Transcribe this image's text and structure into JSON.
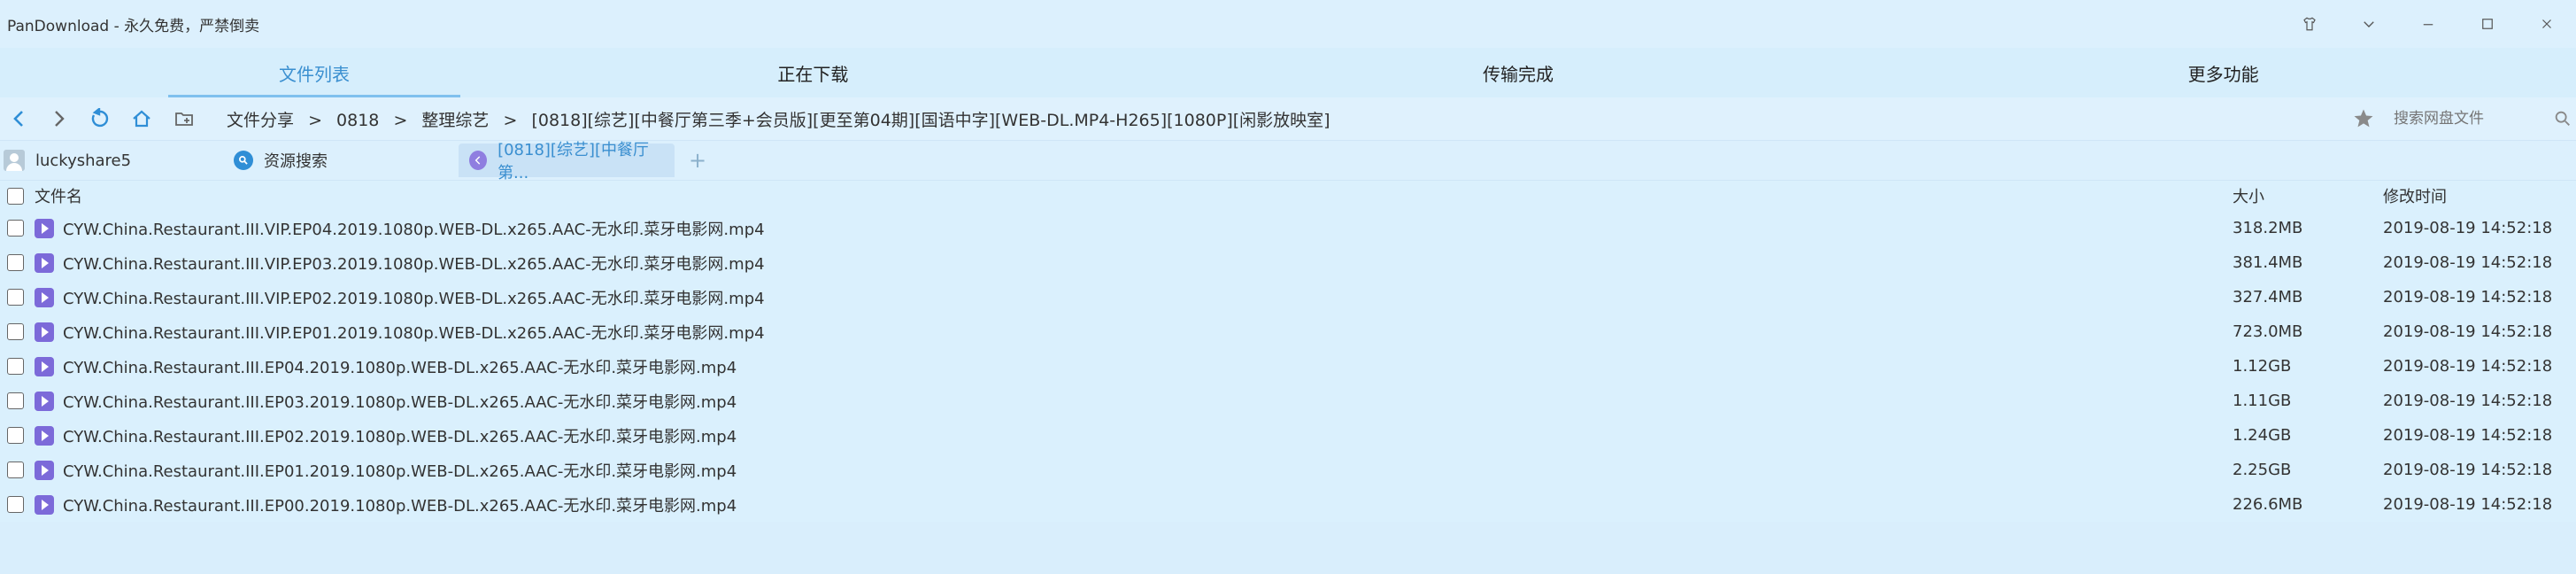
{
  "window": {
    "title": "PanDownload - 永久免费，严禁倒卖",
    "controls": [
      "shirt-icon",
      "chevron-down-icon",
      "minimize-icon",
      "maximize-icon",
      "close-icon"
    ]
  },
  "tabs": [
    {
      "label": "文件列表",
      "active": true
    },
    {
      "label": "正在下载",
      "active": false
    },
    {
      "label": "传输完成",
      "active": false
    },
    {
      "label": "更多功能",
      "active": false
    }
  ],
  "navbar": {
    "breadcrumbs": [
      "文件分享",
      ">",
      "0818",
      ">",
      "整理综艺",
      ">",
      "[0818][综艺][中餐厅第三季+会员版][更至第04期][国语中字][WEB-DL.MP4-H265][1080P][闲影放映室]"
    ],
    "search_placeholder": "搜索网盘文件"
  },
  "account": {
    "username": "luckyshare5",
    "tabs": [
      {
        "label": "资源搜索"
      },
      {
        "label": "[0818][综艺][中餐厅第..."
      }
    ],
    "add_label": "+"
  },
  "filelist": {
    "headers": {
      "name": "文件名",
      "size": "大小",
      "modified": "修改时间"
    },
    "files": [
      {
        "name": "CYW.China.Restaurant.III.VIP.EP04.2019.1080p.WEB-DL.x265.AAC-无水印.菜牙电影网.mp4",
        "size": "318.2MB",
        "modified": "2019-08-19 14:52:18"
      },
      {
        "name": "CYW.China.Restaurant.III.VIP.EP03.2019.1080p.WEB-DL.x265.AAC-无水印.菜牙电影网.mp4",
        "size": "381.4MB",
        "modified": "2019-08-19 14:52:18"
      },
      {
        "name": "CYW.China.Restaurant.III.VIP.EP02.2019.1080p.WEB-DL.x265.AAC-无水印.菜牙电影网.mp4",
        "size": "327.4MB",
        "modified": "2019-08-19 14:52:18"
      },
      {
        "name": "CYW.China.Restaurant.III.VIP.EP01.2019.1080p.WEB-DL.x265.AAC-无水印.菜牙电影网.mp4",
        "size": "723.0MB",
        "modified": "2019-08-19 14:52:18"
      },
      {
        "name": "CYW.China.Restaurant.III.EP04.2019.1080p.WEB-DL.x265.AAC-无水印.菜牙电影网.mp4",
        "size": "1.12GB",
        "modified": "2019-08-19 14:52:18"
      },
      {
        "name": "CYW.China.Restaurant.III.EP03.2019.1080p.WEB-DL.x265.AAC-无水印.菜牙电影网.mp4",
        "size": "1.11GB",
        "modified": "2019-08-19 14:52:18"
      },
      {
        "name": "CYW.China.Restaurant.III.EP02.2019.1080p.WEB-DL.x265.AAC-无水印.菜牙电影网.mp4",
        "size": "1.24GB",
        "modified": "2019-08-19 14:52:18"
      },
      {
        "name": "CYW.China.Restaurant.III.EP01.2019.1080p.WEB-DL.x265.AAC-无水印.菜牙电影网.mp4",
        "size": "2.25GB",
        "modified": "2019-08-19 14:52:18"
      },
      {
        "name": "CYW.China.Restaurant.III.EP00.2019.1080p.WEB-DL.x265.AAC-无水印.菜牙电影网.mp4",
        "size": "226.6MB",
        "modified": "2019-08-19 14:52:18"
      }
    ]
  },
  "colors": {
    "accent": "#3a8fd0",
    "background": "#d9eefc",
    "file_icon": "#7c6ad9",
    "nav_icon": "#2f8ed6"
  }
}
